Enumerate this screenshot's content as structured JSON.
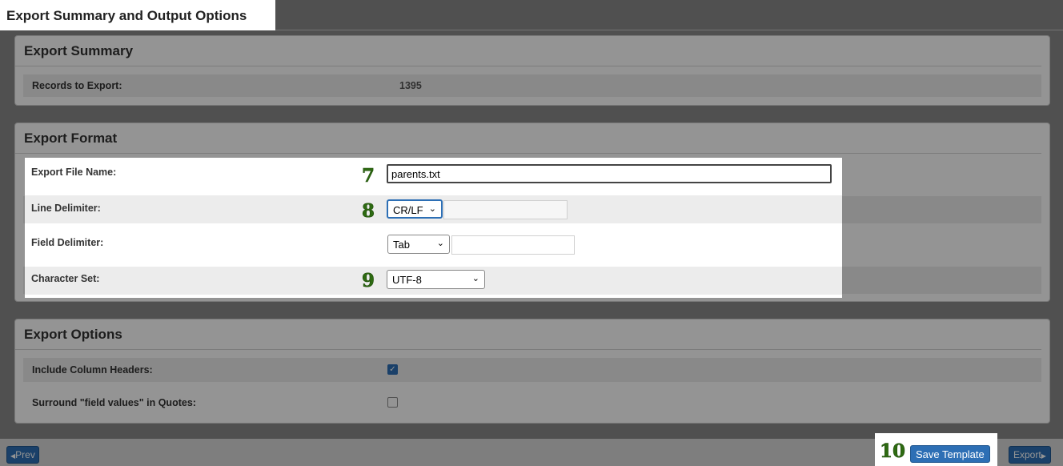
{
  "page_title": "Export Summary and Output Options",
  "summary": {
    "heading": "Export Summary",
    "records_label": "Records to Export:",
    "records_value": "1395"
  },
  "format": {
    "heading": "Export Format",
    "file_name_label": "Export File Name:",
    "file_name_value": "parents.txt",
    "line_delim_label": "Line Delimiter:",
    "line_delim_value": "CR/LF",
    "field_delim_label": "Field Delimiter:",
    "field_delim_value": "Tab",
    "charset_label": "Character Set:",
    "charset_value": "UTF-8"
  },
  "options": {
    "heading": "Export Options",
    "headers_label": "Include Column Headers:",
    "headers_checked": true,
    "quotes_label": "Surround \"field values\" in Quotes:",
    "quotes_checked": false
  },
  "steps": {
    "s7": "7",
    "s8": "8",
    "s9": "9",
    "s10": "10"
  },
  "footer": {
    "prev_label": "Prev",
    "save_template_label": "Save Template",
    "export_label": "Export"
  },
  "colors": {
    "accent": "#2d6fb5",
    "step_number": "#2e6b12"
  }
}
